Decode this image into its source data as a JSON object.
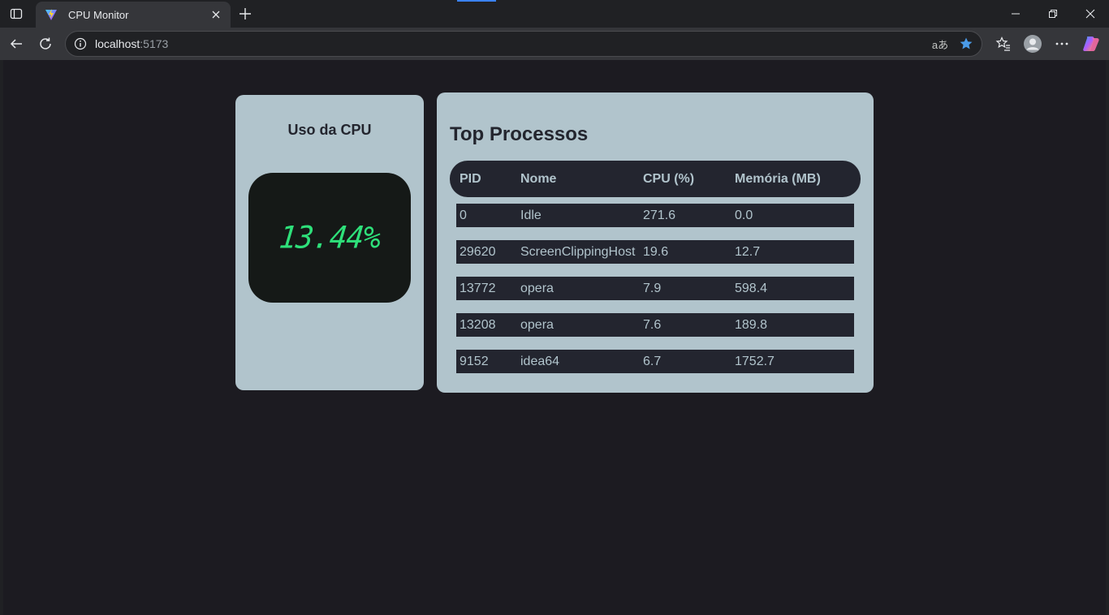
{
  "browser": {
    "tab": {
      "title": "CPU Monitor"
    },
    "address": {
      "host": "localhost",
      "port": ":5173"
    },
    "icons": {
      "tab_actions": "tab-actions-icon",
      "favicon": "vite-logo-icon",
      "close": "close-icon",
      "new_tab": "plus-icon",
      "back": "back-arrow-icon",
      "reload": "reload-icon",
      "site_info": "info-icon",
      "read_aloud": "read-aloud-icon",
      "favorite": "star-icon",
      "favorites": "favorites-icon",
      "profile": "profile-icon",
      "menu": "more-icon",
      "copilot": "copilot-icon"
    },
    "read_aloud_text": "aあ",
    "colors": {
      "accent": "#3b82f6",
      "star": "#4a9be8"
    }
  },
  "cpu_panel": {
    "title": "Uso da CPU",
    "value": "13.44%",
    "value_color": "#2ee07a"
  },
  "process_panel": {
    "title": "Top Processos",
    "columns": [
      "PID",
      "Nome",
      "CPU (%)",
      "Memória (MB)"
    ],
    "rows": [
      {
        "pid": "0",
        "name": "Idle",
        "cpu": "271.6",
        "mem": "0.0"
      },
      {
        "pid": "29620",
        "name": "ScreenClippingHost",
        "cpu": "19.6",
        "mem": "12.7"
      },
      {
        "pid": "13772",
        "name": "opera",
        "cpu": "7.9",
        "mem": "598.4"
      },
      {
        "pid": "13208",
        "name": "opera",
        "cpu": "7.6",
        "mem": "189.8"
      },
      {
        "pid": "9152",
        "name": "idea64",
        "cpu": "6.7",
        "mem": "1752.7"
      }
    ]
  }
}
